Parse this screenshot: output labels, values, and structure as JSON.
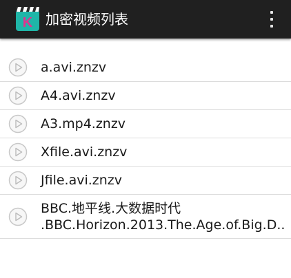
{
  "app": {
    "title": "加密视频列表",
    "icon_letter": "K"
  },
  "colors": {
    "actionbar": "#202020",
    "icon_bg": "#1fb6a8",
    "icon_letter": "#e2328f"
  },
  "files": [
    {
      "name": "a.avi.znzv"
    },
    {
      "name": "A4.avi.znzv"
    },
    {
      "name": "A3.mp4.znzv"
    },
    {
      "name": "Xfile.avi.znzv"
    },
    {
      "name": "Jfile.avi.znzv"
    },
    {
      "name_line1": "BBC.地平线.大数据时代",
      "name_line2": ".BBC.Horizon.2013.The.Age.of.Big.D..."
    }
  ]
}
